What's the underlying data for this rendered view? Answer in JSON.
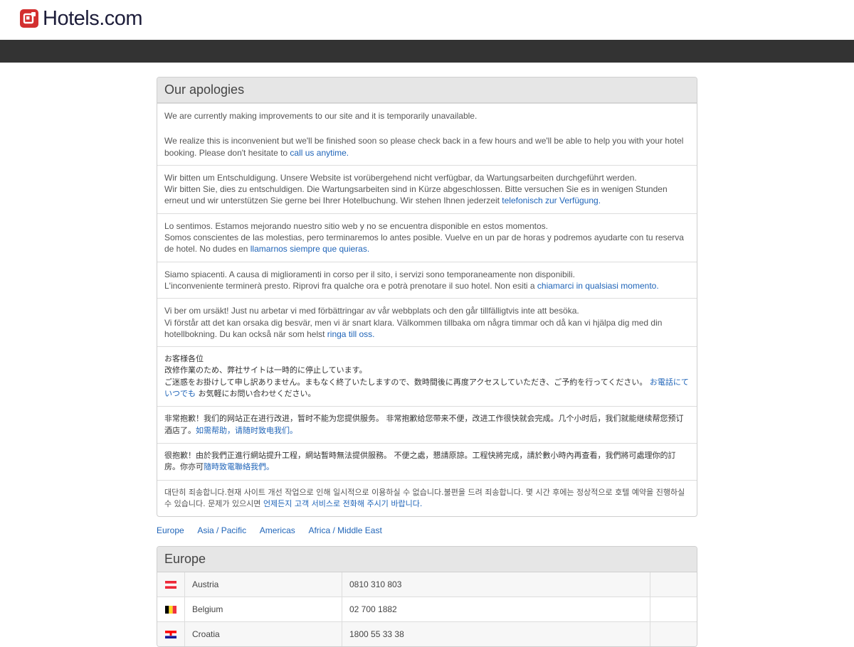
{
  "brand": {
    "name": "Hotels.com",
    "logo_color": "#d32f2f"
  },
  "notice": {
    "title": "Our apologies",
    "english": {
      "p1": "We are currently making improvements to our site and it is temporarily unavailable.",
      "p2": "We realize this is inconvenient but we'll be finished soon so please check back in a few hours and we'll be able to help you with your hotel booking. Please don't hesitate to ",
      "link": "call us anytime."
    },
    "german": {
      "text": "Wir bitten um Entschuldigung. Unsere Website ist vorübergehend nicht verfügbar, da Wartungsarbeiten durchgeführt werden.",
      "text2": "Wir bitten Sie, dies zu entschuldigen. Die Wartungsarbeiten sind in Kürze abgeschlossen. Bitte versuchen Sie es in wenigen Stunden erneut und wir unterstützen Sie gerne bei Ihrer Hotelbuchung. Wir stehen Ihnen jederzeit ",
      "link": "telefonisch zur Verfügung."
    },
    "spanish": {
      "text": "Lo sentimos. Estamos mejorando nuestro sitio web y no se encuentra disponible en estos momentos.",
      "text2": "Somos conscientes de las molestias, pero terminaremos lo antes posible. Vuelve en un par de horas y podremos ayudarte con tu reserva de hotel. No dudes en ",
      "link": "llamarnos siempre que quieras."
    },
    "italian": {
      "text": "Siamo spiacenti. A causa di miglioramenti in corso per il sito, i servizi sono temporaneamente non disponibili.",
      "text2": "L'inconveniente terminerà presto. Riprovi fra qualche ora e potrà prenotare il suo hotel. Non esiti a ",
      "link": "chiamarci in qualsiasi momento."
    },
    "swedish": {
      "text": "Vi ber om ursäkt! Just nu arbetar vi med förbättringar av vår webbplats och den går tillfälligtvis inte att besöka.",
      "text2": "Vi förstår att det kan orsaka dig besvär, men vi är snart klara. Välkommen tillbaka om några timmar och då kan vi hjälpa dig med din hotellbokning. Du kan också när som helst ",
      "link": "ringa till oss."
    },
    "japanese": {
      "line1": "お客様各位",
      "line2": "改修作業のため、弊社サイトは一時的に停止しています。",
      "line3": "ご迷惑をお掛けして申し訳ありません。まもなく終了いたしますので、数時間後に再度アクセスしていただき、ご予約を行ってください。",
      "link": "お電話にていつでも",
      "after": "お気軽にお問い合わせください。"
    },
    "chinese_simplified": {
      "text": "非常抱歉！我们的网站正在进行改进，暂时不能为您提供服务。 非常抱歉给您带来不便，改进工作很快就会完成。几个小时后，我们就能继续帮您预订酒店了。",
      "link": "如需帮助，请随时致电我们。"
    },
    "chinese_traditional": {
      "text": "很抱歉！由於我們正進行網站提升工程，網站暫時無法提供服務。 不便之處，懇請原諒。工程快將完成，請於數小時內再查看，我們將可處理你的訂房。你亦可",
      "link": "隨時致電聯絡我們。"
    },
    "korean": {
      "text": "대단히 죄송합니다.현재 사이트 개선 작업으로 인해 일시적으로 이용하실 수 없습니다.불편을 드려 죄송합니다. 몇 시간 후에는 정상적으로 호텔 예약을 진행하실 수 있습니다. 문제가 있으시면 ",
      "link": "언제든지 고객 서비스로 전화해 주시기 바랍니다."
    }
  },
  "regions": {
    "europe": "Europe",
    "asia_pacific": "Asia / Pacific",
    "americas": "Americas",
    "africa_middle_east": "Africa / Middle East"
  },
  "europe_panel": {
    "title": "Europe",
    "rows": [
      {
        "country": "Austria",
        "phone": "0810 310 803",
        "flag": "austria-flag-icon"
      },
      {
        "country": "Belgium",
        "phone": "02 700 1882",
        "flag": "belgium-flag-icon"
      },
      {
        "country": "Croatia",
        "phone": "1800 55 33 38",
        "flag": "croatia-flag-icon"
      }
    ]
  }
}
